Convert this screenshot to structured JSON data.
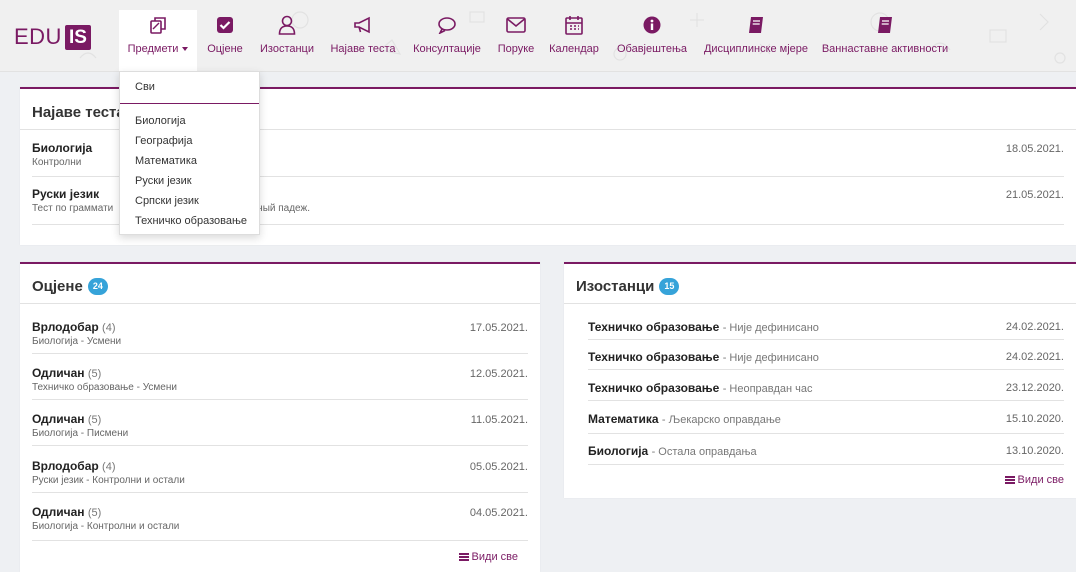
{
  "brand": {
    "logo_text": "EDU",
    "logo_mark": "IS",
    "color": "#7a1a63"
  },
  "nav": [
    {
      "label": "Предмети",
      "icon": "subjects-icon",
      "has_caret": true,
      "active": true
    },
    {
      "label": "Оцјене",
      "icon": "check-square-icon"
    },
    {
      "label": "Изостанци",
      "icon": "person-icon"
    },
    {
      "label": "Најаве теста",
      "icon": "megaphone-icon"
    },
    {
      "label": "Консултације",
      "icon": "chat-icon"
    },
    {
      "label": "Поруке",
      "icon": "envelope-icon"
    },
    {
      "label": "Календар",
      "icon": "calendar-icon"
    },
    {
      "label": "Обавјештења",
      "icon": "info-icon"
    },
    {
      "label": "Дисциплинске мјере",
      "icon": "book-icon"
    },
    {
      "label": "Ваннаставне активности",
      "icon": "book-icon"
    }
  ],
  "subjects_dropdown": {
    "all_label": "Сви",
    "items": [
      "Биологија",
      "Географија",
      "Математика",
      "Руски језик",
      "Српски језик",
      "Техничко образовање"
    ]
  },
  "test_announcements": {
    "title": "Најаве теста",
    "items": [
      {
        "subject": "Биологија",
        "note": "Контролни",
        "date": "18.05.2021."
      },
      {
        "subject": "Руски језик",
        "note": "Тест по граммати... предложный падеж.",
        "note_visible_left": "Тест по граммати",
        "note_visible_right": "дложный падеж.",
        "date": "21.05.2021."
      }
    ]
  },
  "grades": {
    "title": "Оцјене",
    "count": "24",
    "items": [
      {
        "grade": "Врлодобар",
        "value": "(4)",
        "detail": "Биологија - Усмени",
        "date": "17.05.2021."
      },
      {
        "grade": "Одличан",
        "value": "(5)",
        "detail": "Техничко образовање - Усмени",
        "date": "12.05.2021."
      },
      {
        "grade": "Одличан",
        "value": "(5)",
        "detail": "Биологија - Писмени",
        "date": "11.05.2021."
      },
      {
        "grade": "Врлодобар",
        "value": "(4)",
        "detail": "Руски језик - Контролни и остали",
        "date": "05.05.2021."
      },
      {
        "grade": "Одличан",
        "value": "(5)",
        "detail": "Биологија - Контролни и остали",
        "date": "04.05.2021."
      }
    ],
    "see_all": "Види све"
  },
  "absences": {
    "title": "Изостанци",
    "count": "15",
    "items": [
      {
        "subject": "Техничко образовање",
        "reason": "- Није дефинисано",
        "date": "24.02.2021."
      },
      {
        "subject": "Техничко образовање",
        "reason": "- Није дефинисано",
        "date": "24.02.2021."
      },
      {
        "subject": "Техничко образовање",
        "reason": "- Неоправдан час",
        "date": "23.12.2020."
      },
      {
        "subject": "Математика",
        "reason": "- Љекарско оправдање",
        "date": "15.10.2020."
      },
      {
        "subject": "Биологија",
        "reason": "- Остала оправдања",
        "date": "13.10.2020."
      }
    ],
    "see_all": "Види све"
  }
}
